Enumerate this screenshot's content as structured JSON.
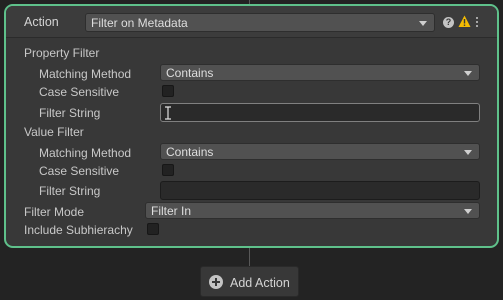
{
  "header": {
    "label": "Action",
    "action_value": "Filter on Metadata",
    "help_icon": "help-icon",
    "warning_icon": "warning-icon",
    "menu_icon": "kebab-menu-icon",
    "warning_color": "#f4bc02"
  },
  "property_filter": {
    "title": "Property Filter",
    "matching_method_label": "Matching Method",
    "matching_method_value": "Contains",
    "case_sensitive_label": "Case Sensitive",
    "case_sensitive_checked": false,
    "filter_string_label": "Filter String",
    "filter_string_value": ""
  },
  "value_filter": {
    "title": "Value Filter",
    "matching_method_label": "Matching Method",
    "matching_method_value": "Contains",
    "case_sensitive_label": "Case Sensitive",
    "case_sensitive_checked": false,
    "filter_string_label": "Filter String",
    "filter_string_value": ""
  },
  "filter_mode": {
    "label": "Filter Mode",
    "value": "Filter In"
  },
  "include_subhierarchy": {
    "label": "Include Subhierachy",
    "checked": false
  },
  "footer": {
    "add_action_label": "Add Action"
  },
  "colors": {
    "accent_border": "#5fc18b",
    "background": "#232323",
    "card": "#383838"
  }
}
